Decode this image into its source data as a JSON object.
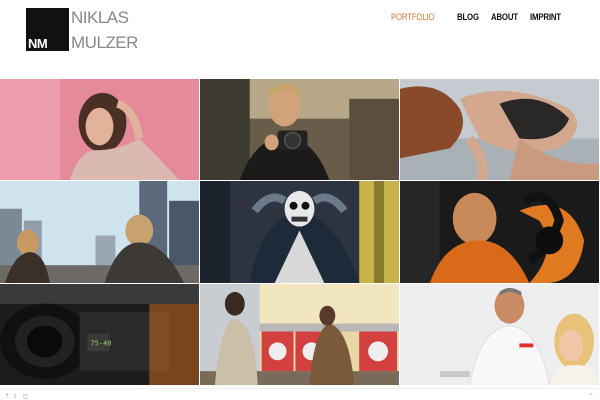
{
  "site": {
    "logo_mark": "NM",
    "first_name": "NIKLAS",
    "last_name": "MULZER"
  },
  "nav": {
    "items": [
      {
        "label": "PORTFOLIO",
        "active": true
      },
      {
        "label": "BLOG",
        "active": false
      },
      {
        "label": "ABOUT",
        "active": false
      },
      {
        "label": "IMPRINT",
        "active": false
      }
    ],
    "accent_color": "#d17b33"
  },
  "gallery": {
    "tiles": [
      {
        "subject": "woman-pink-background"
      },
      {
        "subject": "man-with-camera"
      },
      {
        "subject": "woman-lying-black-lingerie"
      },
      {
        "subject": "people-city-skyline"
      },
      {
        "subject": "person-skull-mask"
      },
      {
        "subject": "bald-man-orange-jacket-headphones"
      },
      {
        "subject": "cinema-camera-closeup"
      },
      {
        "subject": "woman-laundromat"
      },
      {
        "subject": "dentist-and-woman"
      }
    ]
  },
  "footer": {
    "social_icons": [
      "facebook-icon",
      "twitter-icon",
      "instagram-icon"
    ],
    "back_to_top": "⌃"
  }
}
